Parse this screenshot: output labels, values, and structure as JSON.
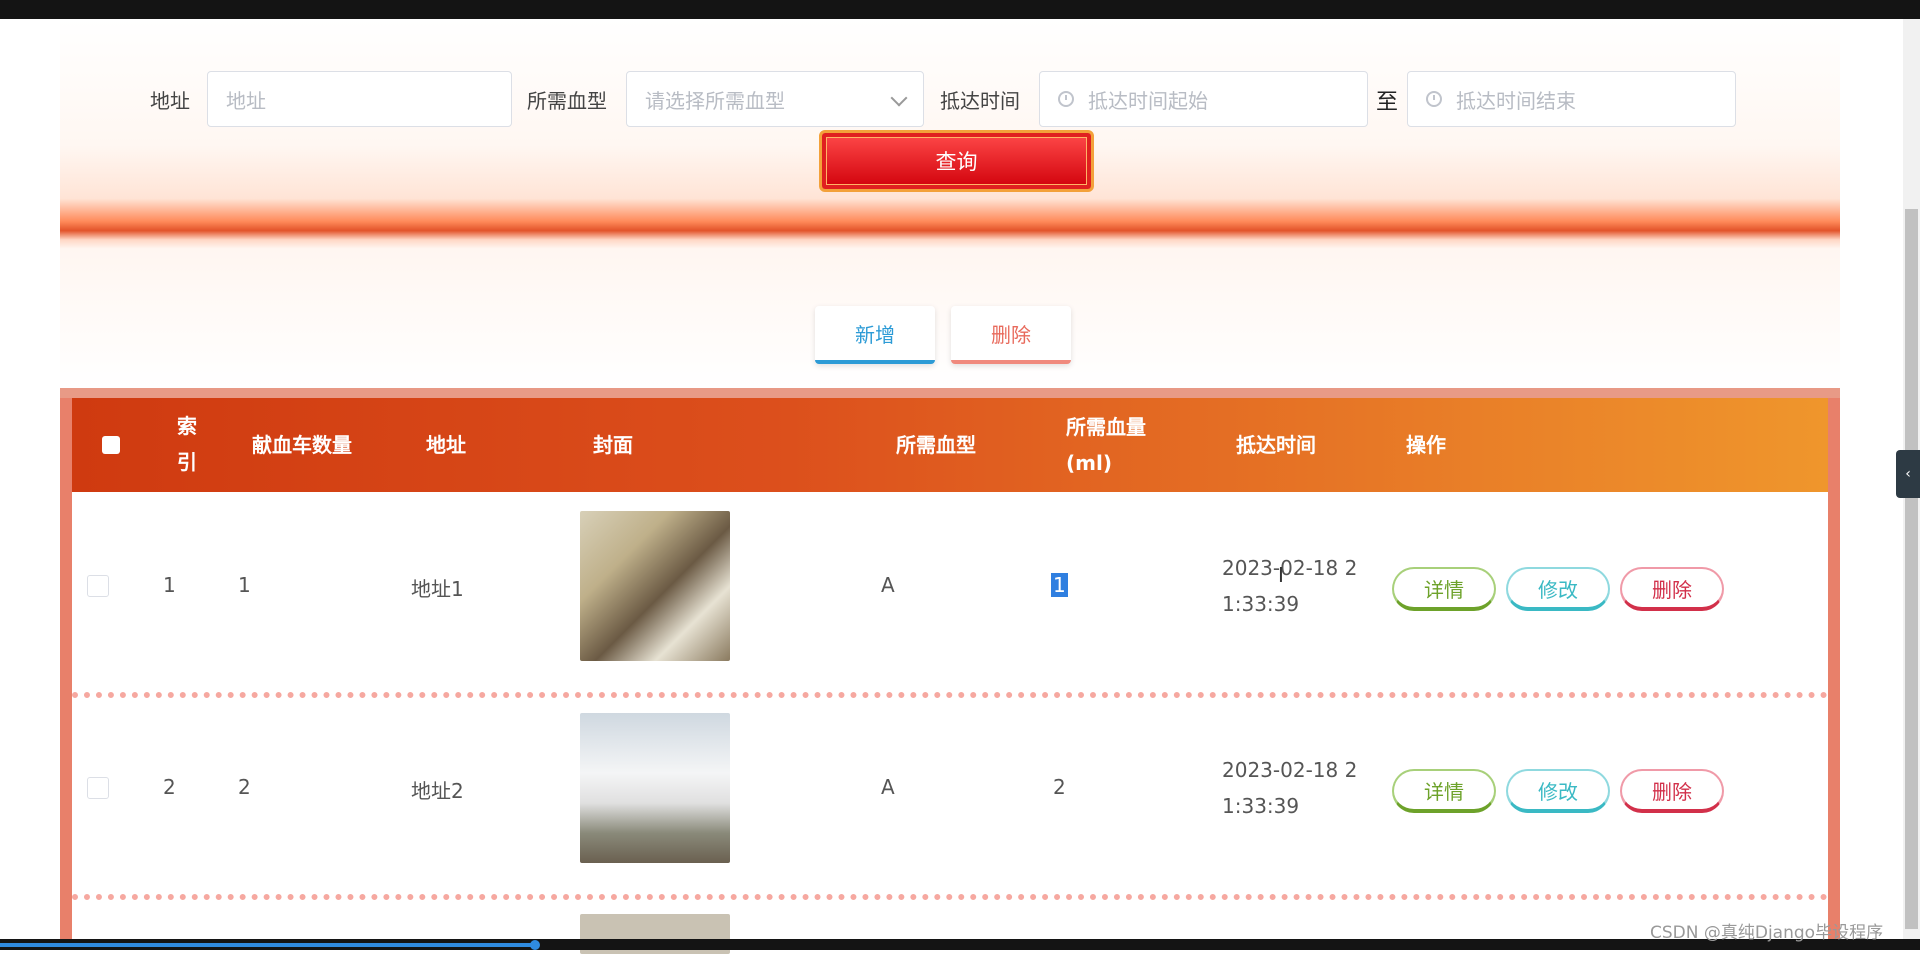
{
  "search": {
    "address_label": "地址",
    "address_placeholder": "地址",
    "blood_type_label": "所需血型",
    "blood_type_placeholder": "请选择所需血型",
    "arrival_label": "抵达时间",
    "arrival_start_placeholder": "抵达时间起始",
    "range_separator": "至",
    "arrival_end_placeholder": "抵达时间结束",
    "query_button": "查询"
  },
  "actions": {
    "add_button": "新增",
    "delete_button": "删除"
  },
  "table": {
    "columns": {
      "select": "",
      "index": "索引",
      "car_count": "献血车数量",
      "address": "地址",
      "cover": "封面",
      "blood_type": "所需血型",
      "blood_volume_line1": "所需血量",
      "blood_volume_line2": "(ml)",
      "arrival_time": "抵达时间",
      "operation": "操作"
    },
    "rows": [
      {
        "index": "1",
        "car_count": "1",
        "address": "地址1",
        "cover_icon": "interior-photo",
        "blood_type": "A",
        "blood_volume": "1",
        "arrival_time_line1": "2023-02-18 2",
        "arrival_time_line2": "1:33:39",
        "detail_button": "详情",
        "edit_button": "修改",
        "delete_button": "删除"
      },
      {
        "index": "2",
        "car_count": "2",
        "address": "地址2",
        "cover_icon": "van-photo",
        "blood_type": "A",
        "blood_volume": "2",
        "arrival_time_line1": "2023-02-18 2",
        "arrival_time_line2": "1:33:39",
        "detail_button": "详情",
        "edit_button": "修改",
        "delete_button": "删除"
      }
    ]
  },
  "watermark": "CSDN @真纯Django毕设程序",
  "colors": {
    "header_start": "#cf3a10",
    "header_end": "#ef962c",
    "query_button": "#d0000a",
    "add_accent": "#2c9bd6",
    "delete_accent": "#e86a5c"
  }
}
